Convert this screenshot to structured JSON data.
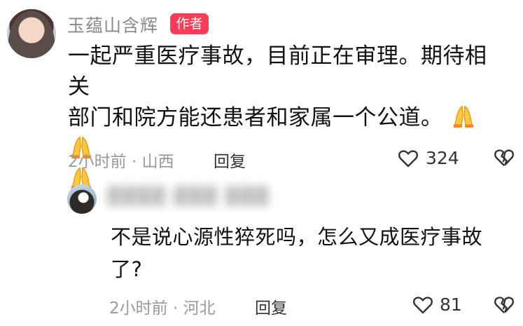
{
  "main_comment": {
    "author": "玉蕴山含辉",
    "badge": "作者",
    "text_line1": "一起严重医疗事故，目前正在审理。期待相关",
    "text_line2": "部门和院方能还患者和家属一个公道。",
    "time_location": "2小时前 · 山西",
    "reply_label": "回复",
    "like_count": "324",
    "emoji": "pray-emoji"
  },
  "reply_comment": {
    "author": "▓▓▓▓ ▓▓▓ ▓▓▓",
    "text": "不是说心源性猝死吗，怎么又成医疗事故了?",
    "time_location": "2小时前 · 河北",
    "reply_label": "回复",
    "like_count": "81"
  },
  "colors": {
    "badge": "#fa3c57",
    "meta": "#9a9a9a",
    "text": "#111111"
  }
}
